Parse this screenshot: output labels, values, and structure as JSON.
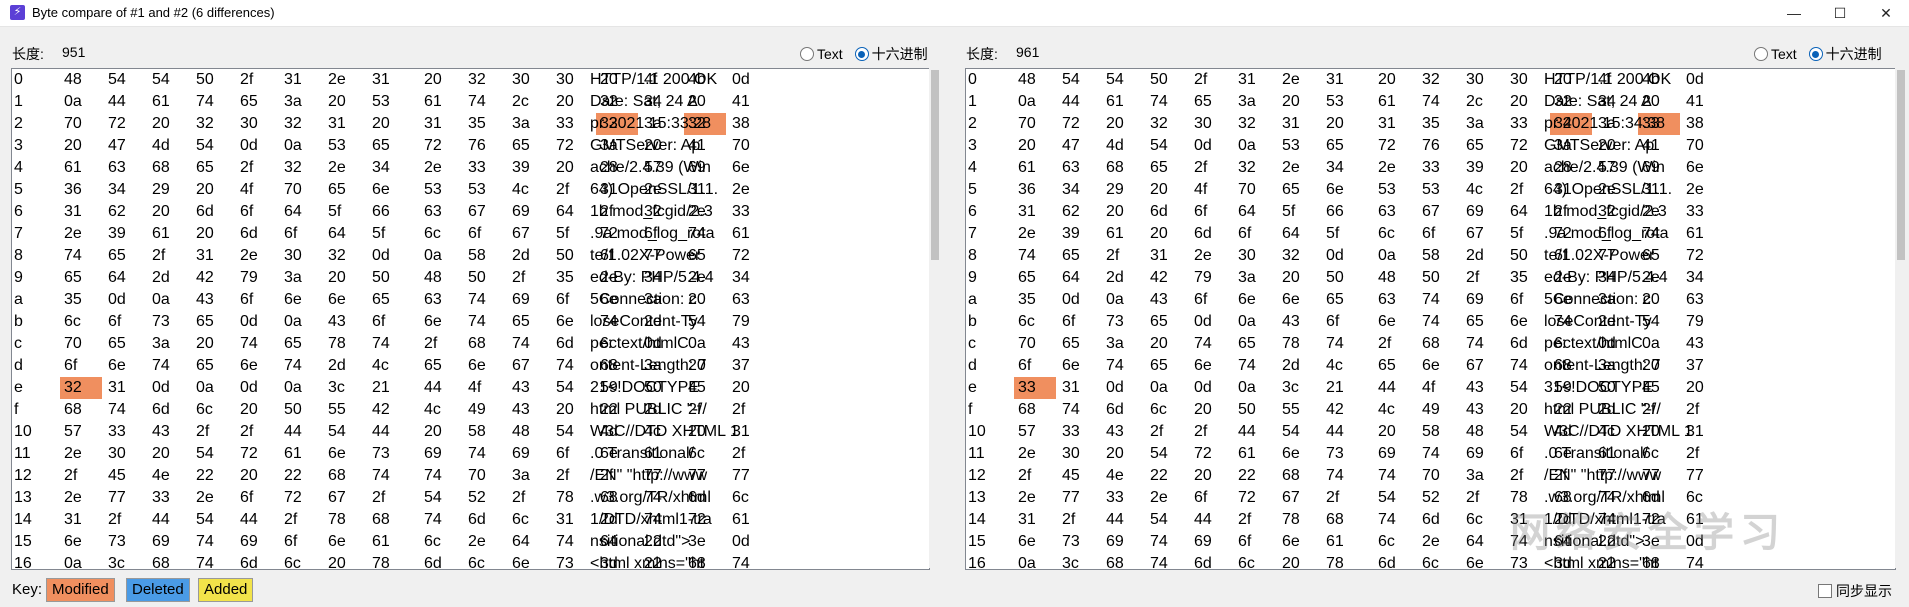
{
  "window": {
    "title": "Byte compare of #1 and #2  (6 differences)",
    "icon": "⚡",
    "minimize": "—",
    "maximize": "☐",
    "close": "✕"
  },
  "left": {
    "length_label": "长度:",
    "length_value": "951",
    "mode_text": "Text",
    "mode_hex": "十六进制",
    "selected_mode": "hex",
    "rows": [
      {
        "idx": "0",
        "bytes": [
          "48",
          "54",
          "54",
          "50",
          "2f",
          "31",
          "2e",
          "31",
          "20",
          "32",
          "30",
          "30",
          "20",
          "4f",
          "4b",
          "0d"
        ],
        "text": "HTTP/1.1 200 OK",
        "mod": []
      },
      {
        "idx": "1",
        "bytes": [
          "0a",
          "44",
          "61",
          "74",
          "65",
          "3a",
          "20",
          "53",
          "61",
          "74",
          "2c",
          "20",
          "32",
          "34",
          "20",
          "41"
        ],
        "text": "Date: Sat, 24 A",
        "mod": []
      },
      {
        "idx": "2",
        "bytes": [
          "70",
          "72",
          "20",
          "32",
          "30",
          "32",
          "31",
          "20",
          "31",
          "35",
          "3a",
          "33",
          "33",
          "3a",
          "32",
          "38"
        ],
        "text": "pr 2021 15:33:28",
        "mod": [
          12,
          14
        ]
      },
      {
        "idx": "3",
        "bytes": [
          "20",
          "47",
          "4d",
          "54",
          "0d",
          "0a",
          "53",
          "65",
          "72",
          "76",
          "65",
          "72",
          "3a",
          "20",
          "41",
          "70"
        ],
        "text": " GMTServer: Ap",
        "mod": []
      },
      {
        "idx": "4",
        "bytes": [
          "61",
          "63",
          "68",
          "65",
          "2f",
          "32",
          "2e",
          "34",
          "2e",
          "33",
          "39",
          "20",
          "28",
          "57",
          "69",
          "6e"
        ],
        "text": "ache/2.4.39 (Win",
        "mod": []
      },
      {
        "idx": "5",
        "bytes": [
          "36",
          "34",
          "29",
          "20",
          "4f",
          "70",
          "65",
          "6e",
          "53",
          "53",
          "4c",
          "2f",
          "31",
          "2e",
          "31",
          "2e"
        ],
        "text": "64) OpenSSL/1.1.",
        "mod": []
      },
      {
        "idx": "6",
        "bytes": [
          "31",
          "62",
          "20",
          "6d",
          "6f",
          "64",
          "5f",
          "66",
          "63",
          "67",
          "69",
          "64",
          "2f",
          "32",
          "2e",
          "33"
        ],
        "text": "1b mod_fcgid/2.3",
        "mod": []
      },
      {
        "idx": "7",
        "bytes": [
          "2e",
          "39",
          "61",
          "20",
          "6d",
          "6f",
          "64",
          "5f",
          "6c",
          "6f",
          "67",
          "5f",
          "72",
          "6f",
          "74",
          "61"
        ],
        "text": ".9a mod_log_rota",
        "mod": []
      },
      {
        "idx": "8",
        "bytes": [
          "74",
          "65",
          "2f",
          "31",
          "2e",
          "30",
          "32",
          "0d",
          "0a",
          "58",
          "2d",
          "50",
          "6f",
          "77",
          "65",
          "72"
        ],
        "text": "te/1.02X-Power",
        "mod": []
      },
      {
        "idx": "9",
        "bytes": [
          "65",
          "64",
          "2d",
          "42",
          "79",
          "3a",
          "20",
          "50",
          "48",
          "50",
          "2f",
          "35",
          "2e",
          "34",
          "2e",
          "34"
        ],
        "text": "ed-By: PHP/5.4.4",
        "mod": []
      },
      {
        "idx": "a",
        "bytes": [
          "35",
          "0d",
          "0a",
          "43",
          "6f",
          "6e",
          "6e",
          "65",
          "63",
          "74",
          "69",
          "6f",
          "6e",
          "3a",
          "20",
          "63"
        ],
        "text": "5Connection: c",
        "mod": []
      },
      {
        "idx": "b",
        "bytes": [
          "6c",
          "6f",
          "73",
          "65",
          "0d",
          "0a",
          "43",
          "6f",
          "6e",
          "74",
          "65",
          "6e",
          "74",
          "2d",
          "54",
          "79"
        ],
        "text": "loseContent-Ty",
        "mod": []
      },
      {
        "idx": "c",
        "bytes": [
          "70",
          "65",
          "3a",
          "20",
          "74",
          "65",
          "78",
          "74",
          "2f",
          "68",
          "74",
          "6d",
          "6c",
          "0d",
          "0a",
          "43"
        ],
        "text": "pe: text/htmlC",
        "mod": []
      },
      {
        "idx": "d",
        "bytes": [
          "6f",
          "6e",
          "74",
          "65",
          "6e",
          "74",
          "2d",
          "4c",
          "65",
          "6e",
          "67",
          "74",
          "68",
          "3a",
          "20",
          "37"
        ],
        "text": "ontent-Length: 7",
        "mod": []
      },
      {
        "idx": "e",
        "bytes": [
          "32",
          "31",
          "0d",
          "0a",
          "0d",
          "0a",
          "3c",
          "21",
          "44",
          "4f",
          "43",
          "54",
          "59",
          "50",
          "45",
          "20"
        ],
        "text": "21<!DOCTYPE",
        "mod": [
          0
        ]
      },
      {
        "idx": "f",
        "bytes": [
          "68",
          "74",
          "6d",
          "6c",
          "20",
          "50",
          "55",
          "42",
          "4c",
          "49",
          "43",
          "20",
          "22",
          "2d",
          "2f",
          "2f"
        ],
        "text": "html PUBLIC \"-//",
        "mod": []
      },
      {
        "idx": "10",
        "bytes": [
          "57",
          "33",
          "43",
          "2f",
          "2f",
          "44",
          "54",
          "44",
          "20",
          "58",
          "48",
          "54",
          "4d",
          "4c",
          "20",
          "31"
        ],
        "text": "W3C//DTD XHTML 1",
        "mod": []
      },
      {
        "idx": "11",
        "bytes": [
          "2e",
          "30",
          "20",
          "54",
          "72",
          "61",
          "6e",
          "73",
          "69",
          "74",
          "69",
          "6f",
          "6e",
          "61",
          "6c",
          "2f"
        ],
        "text": ".0 Transitional/",
        "mod": []
      },
      {
        "idx": "12",
        "bytes": [
          "2f",
          "45",
          "4e",
          "22",
          "20",
          "22",
          "68",
          "74",
          "74",
          "70",
          "3a",
          "2f",
          "2f",
          "77",
          "77",
          "77"
        ],
        "text": "/EN\" \"http://www",
        "mod": []
      },
      {
        "idx": "13",
        "bytes": [
          "2e",
          "77",
          "33",
          "2e",
          "6f",
          "72",
          "67",
          "2f",
          "54",
          "52",
          "2f",
          "78",
          "68",
          "74",
          "6d",
          "6c"
        ],
        "text": ".w3.org/TR/xhtml",
        "mod": []
      },
      {
        "idx": "14",
        "bytes": [
          "31",
          "2f",
          "44",
          "54",
          "44",
          "2f",
          "78",
          "68",
          "74",
          "6d",
          "6c",
          "31",
          "2d",
          "74",
          "72",
          "61"
        ],
        "text": "1/DTD/xhtml1-tra",
        "mod": []
      },
      {
        "idx": "15",
        "bytes": [
          "6e",
          "73",
          "69",
          "74",
          "69",
          "6f",
          "6e",
          "61",
          "6c",
          "2e",
          "64",
          "74",
          "64",
          "22",
          "3e",
          "0d"
        ],
        "text": "nsitional.dtd\">",
        "mod": []
      },
      {
        "idx": "16",
        "bytes": [
          "0a",
          "3c",
          "68",
          "74",
          "6d",
          "6c",
          "20",
          "78",
          "6d",
          "6c",
          "6e",
          "73",
          "3d",
          "22",
          "68",
          "74"
        ],
        "text": "<html xmlns=\"ht",
        "mod": []
      }
    ]
  },
  "right": {
    "length_label": "长度:",
    "length_value": "961",
    "mode_text": "Text",
    "mode_hex": "十六进制",
    "selected_mode": "hex",
    "rows": [
      {
        "idx": "0",
        "bytes": [
          "48",
          "54",
          "54",
          "50",
          "2f",
          "31",
          "2e",
          "31",
          "20",
          "32",
          "30",
          "30",
          "20",
          "4f",
          "4b",
          "0d"
        ],
        "text": "HTTP/1.1 200 OK",
        "mod": []
      },
      {
        "idx": "1",
        "bytes": [
          "0a",
          "44",
          "61",
          "74",
          "65",
          "3a",
          "20",
          "53",
          "61",
          "74",
          "2c",
          "20",
          "32",
          "34",
          "20",
          "41"
        ],
        "text": "Date: Sat, 24 A",
        "mod": []
      },
      {
        "idx": "2",
        "bytes": [
          "70",
          "72",
          "20",
          "32",
          "30",
          "32",
          "31",
          "20",
          "31",
          "35",
          "3a",
          "33",
          "34",
          "3a",
          "33",
          "38"
        ],
        "text": "pr 2021 15:34:38",
        "mod": [
          12,
          14
        ]
      },
      {
        "idx": "3",
        "bytes": [
          "20",
          "47",
          "4d",
          "54",
          "0d",
          "0a",
          "53",
          "65",
          "72",
          "76",
          "65",
          "72",
          "3a",
          "20",
          "41",
          "70"
        ],
        "text": " GMTServer: Ap",
        "mod": []
      },
      {
        "idx": "4",
        "bytes": [
          "61",
          "63",
          "68",
          "65",
          "2f",
          "32",
          "2e",
          "34",
          "2e",
          "33",
          "39",
          "20",
          "28",
          "57",
          "69",
          "6e"
        ],
        "text": "ache/2.4.39 (Win",
        "mod": []
      },
      {
        "idx": "5",
        "bytes": [
          "36",
          "34",
          "29",
          "20",
          "4f",
          "70",
          "65",
          "6e",
          "53",
          "53",
          "4c",
          "2f",
          "31",
          "2e",
          "31",
          "2e"
        ],
        "text": "64) OpenSSL/1.1.",
        "mod": []
      },
      {
        "idx": "6",
        "bytes": [
          "31",
          "62",
          "20",
          "6d",
          "6f",
          "64",
          "5f",
          "66",
          "63",
          "67",
          "69",
          "64",
          "2f",
          "32",
          "2e",
          "33"
        ],
        "text": "1b mod_fcgid/2.3",
        "mod": []
      },
      {
        "idx": "7",
        "bytes": [
          "2e",
          "39",
          "61",
          "20",
          "6d",
          "6f",
          "64",
          "5f",
          "6c",
          "6f",
          "67",
          "5f",
          "72",
          "6f",
          "74",
          "61"
        ],
        "text": ".9a mod_log_rota",
        "mod": []
      },
      {
        "idx": "8",
        "bytes": [
          "74",
          "65",
          "2f",
          "31",
          "2e",
          "30",
          "32",
          "0d",
          "0a",
          "58",
          "2d",
          "50",
          "6f",
          "77",
          "65",
          "72"
        ],
        "text": "te/1.02X-Power",
        "mod": []
      },
      {
        "idx": "9",
        "bytes": [
          "65",
          "64",
          "2d",
          "42",
          "79",
          "3a",
          "20",
          "50",
          "48",
          "50",
          "2f",
          "35",
          "2e",
          "34",
          "2e",
          "34"
        ],
        "text": "ed-By: PHP/5.4.4",
        "mod": []
      },
      {
        "idx": "a",
        "bytes": [
          "35",
          "0d",
          "0a",
          "43",
          "6f",
          "6e",
          "6e",
          "65",
          "63",
          "74",
          "69",
          "6f",
          "6e",
          "3a",
          "20",
          "63"
        ],
        "text": "5Connection: c",
        "mod": []
      },
      {
        "idx": "b",
        "bytes": [
          "6c",
          "6f",
          "73",
          "65",
          "0d",
          "0a",
          "43",
          "6f",
          "6e",
          "74",
          "65",
          "6e",
          "74",
          "2d",
          "54",
          "79"
        ],
        "text": "loseContent-Ty",
        "mod": []
      },
      {
        "idx": "c",
        "bytes": [
          "70",
          "65",
          "3a",
          "20",
          "74",
          "65",
          "78",
          "74",
          "2f",
          "68",
          "74",
          "6d",
          "6c",
          "0d",
          "0a",
          "43"
        ],
        "text": "pe: text/htmlC",
        "mod": []
      },
      {
        "idx": "d",
        "bytes": [
          "6f",
          "6e",
          "74",
          "65",
          "6e",
          "74",
          "2d",
          "4c",
          "65",
          "6e",
          "67",
          "74",
          "68",
          "3a",
          "20",
          "37"
        ],
        "text": "ontent-Length: 7",
        "mod": []
      },
      {
        "idx": "e",
        "bytes": [
          "33",
          "31",
          "0d",
          "0a",
          "0d",
          "0a",
          "3c",
          "21",
          "44",
          "4f",
          "43",
          "54",
          "59",
          "50",
          "45",
          "20"
        ],
        "text": "31<!DOCTYPE",
        "mod": [
          0
        ]
      },
      {
        "idx": "f",
        "bytes": [
          "68",
          "74",
          "6d",
          "6c",
          "20",
          "50",
          "55",
          "42",
          "4c",
          "49",
          "43",
          "20",
          "22",
          "2d",
          "2f",
          "2f"
        ],
        "text": "html PUBLIC \"-//",
        "mod": []
      },
      {
        "idx": "10",
        "bytes": [
          "57",
          "33",
          "43",
          "2f",
          "2f",
          "44",
          "54",
          "44",
          "20",
          "58",
          "48",
          "54",
          "4d",
          "4c",
          "20",
          "31"
        ],
        "text": "W3C//DTD XHTML 1",
        "mod": []
      },
      {
        "idx": "11",
        "bytes": [
          "2e",
          "30",
          "20",
          "54",
          "72",
          "61",
          "6e",
          "73",
          "69",
          "74",
          "69",
          "6f",
          "6e",
          "61",
          "6c",
          "2f"
        ],
        "text": ".0 Transitional/",
        "mod": []
      },
      {
        "idx": "12",
        "bytes": [
          "2f",
          "45",
          "4e",
          "22",
          "20",
          "22",
          "68",
          "74",
          "74",
          "70",
          "3a",
          "2f",
          "2f",
          "77",
          "77",
          "77"
        ],
        "text": "/EN\" \"http://www",
        "mod": []
      },
      {
        "idx": "13",
        "bytes": [
          "2e",
          "77",
          "33",
          "2e",
          "6f",
          "72",
          "67",
          "2f",
          "54",
          "52",
          "2f",
          "78",
          "68",
          "74",
          "6d",
          "6c"
        ],
        "text": ".w3.org/TR/xhtml",
        "mod": []
      },
      {
        "idx": "14",
        "bytes": [
          "31",
          "2f",
          "44",
          "54",
          "44",
          "2f",
          "78",
          "68",
          "74",
          "6d",
          "6c",
          "31",
          "2d",
          "74",
          "72",
          "61"
        ],
        "text": "1/DTD/xhtml1-tra",
        "mod": []
      },
      {
        "idx": "15",
        "bytes": [
          "6e",
          "73",
          "69",
          "74",
          "69",
          "6f",
          "6e",
          "61",
          "6c",
          "2e",
          "64",
          "74",
          "64",
          "22",
          "3e",
          "0d"
        ],
        "text": "nsitional.dtd\">",
        "mod": []
      },
      {
        "idx": "16",
        "bytes": [
          "0a",
          "3c",
          "68",
          "74",
          "6d",
          "6c",
          "20",
          "78",
          "6d",
          "6c",
          "6e",
          "73",
          "3d",
          "22",
          "68",
          "74"
        ],
        "text": "<html xmlns=\"ht",
        "mod": []
      }
    ]
  },
  "key": {
    "label": "Key:",
    "modified": "Modified",
    "deleted": "Deleted",
    "added": "Added",
    "modified_color": "#f08f5f",
    "deleted_color": "#4a9be6",
    "added_color": "#f2e34a"
  },
  "sync_label": "同步显示",
  "watermark": "网络安全学习",
  "colors": {
    "modified_byte": "#f08f5f"
  }
}
